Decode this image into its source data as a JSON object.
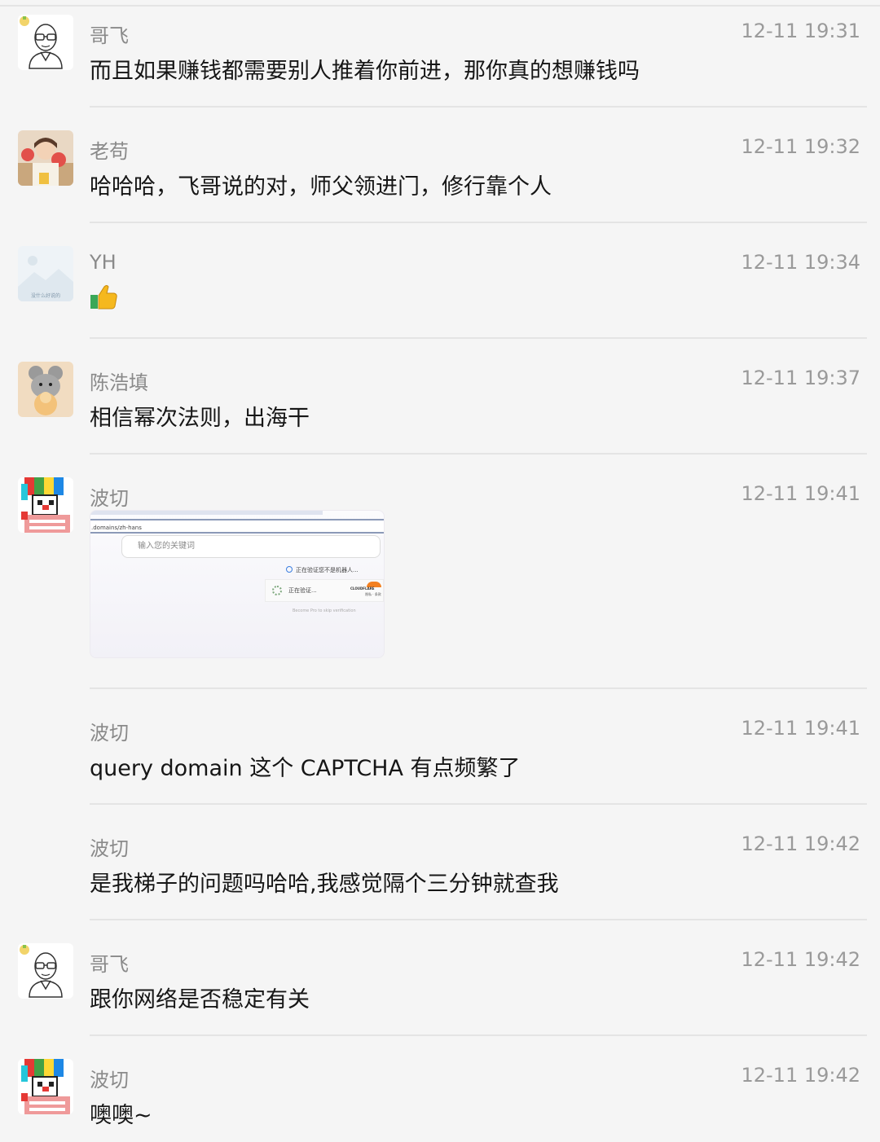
{
  "messages": [
    {
      "sender": "哥飞",
      "time": "12-11 19:31",
      "text": "而且如果赚钱都需要别人推着你前进，那你真的想赚钱吗",
      "avatar": "glasses-man"
    },
    {
      "sender": "老苟",
      "time": "12-11 19:32",
      "text": "哈哈哈，飞哥说的对，师父领进门，修行靠个人",
      "avatar": "girl-photo"
    },
    {
      "sender": "YH",
      "time": "12-11 19:34",
      "text": "",
      "avatar": "landscape-placeholder",
      "avatar_caption": "没什么好说的"
    },
    {
      "sender": "陈浩填",
      "time": "12-11 19:37",
      "text": "相信幂次法则，出海干",
      "avatar": "cartoon-mouse"
    },
    {
      "sender": "波切",
      "time": "12-11 19:41",
      "text": "",
      "avatar": "pixel-clown"
    },
    {
      "sender": "波切",
      "time": "12-11 19:41",
      "text": "query domain 这个 CAPTCHA 有点频繁了"
    },
    {
      "sender": "波切",
      "time": "12-11 19:42",
      "text": "是我梯子的问题吗哈哈,我感觉隔个三分钟就查我"
    },
    {
      "sender": "哥飞",
      "time": "12-11 19:42",
      "text": "跟你网络是否稳定有关",
      "avatar": "glasses-man"
    },
    {
      "sender": "波切",
      "time": "12-11 19:42",
      "text": "噢噢~",
      "avatar": "pixel-clown"
    }
  ],
  "thumbs_up_icon": "thumbs-up-icon",
  "screenshot": {
    "url": ".domains/zh-hans",
    "search_placeholder": "输入您的关键词",
    "verifying_human": "正在验证您不是机器人...",
    "verifying": "正在验证...",
    "brand": "CLOUDFLARE",
    "brand_sub": "隐私 · 条款",
    "skip_text": "Become Pro to skip verification"
  }
}
